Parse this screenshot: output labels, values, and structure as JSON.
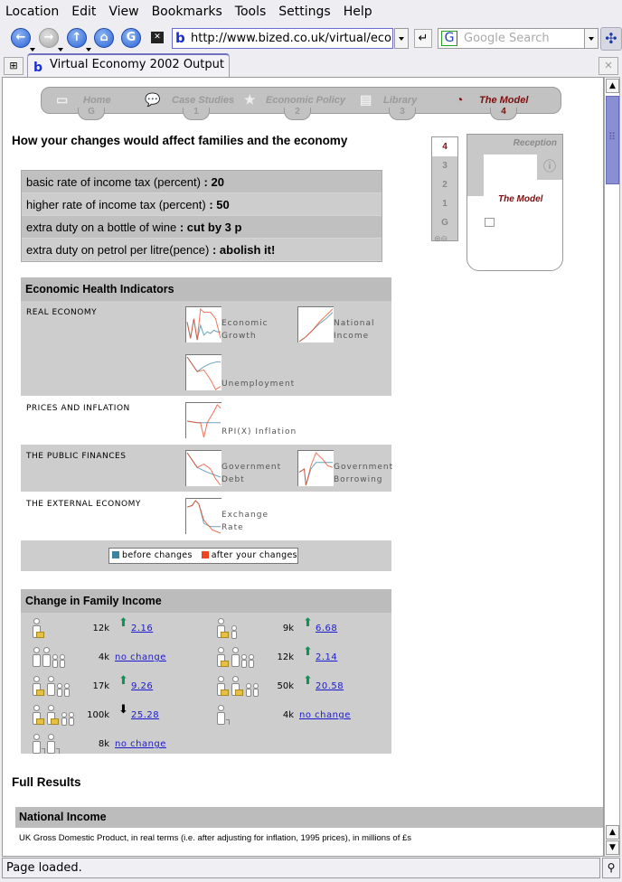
{
  "browser": {
    "menu": [
      "Location",
      "Edit",
      "View",
      "Bookmarks",
      "Tools",
      "Settings",
      "Help"
    ],
    "url": "http://www.bized.co.uk/virtual/econc",
    "search_placeholder": "Google Search",
    "tab_title": "Virtual Economy 2002 Output",
    "status": "Page loaded.",
    "icons": {
      "back": "back-arrow-icon",
      "forward": "forward-arrow-icon",
      "up": "up-arrow-icon",
      "home": "home-icon",
      "reload": "reload-icon",
      "stop": "stop-icon"
    }
  },
  "site_nav": {
    "items": [
      {
        "label": "Home",
        "floor": "G",
        "icon": "briefcase-icon",
        "active": false
      },
      {
        "label": "Case Studies",
        "floor": "1",
        "icon": "speech-bubbles-icon",
        "active": false
      },
      {
        "label": "Economic Policy",
        "floor": "2",
        "icon": "star-icon",
        "active": false
      },
      {
        "label": "Library",
        "floor": "3",
        "icon": "book-icon",
        "active": false
      },
      {
        "label": "The Model",
        "floor": "4",
        "icon": "pie-chart-icon",
        "active": true
      }
    ]
  },
  "lift": {
    "floors": [
      "4",
      "3",
      "2",
      "1",
      "G"
    ],
    "current": "4"
  },
  "floor_map": {
    "reception": "Reception",
    "room": "The Model"
  },
  "page": {
    "heading": "How your changes would affect families and the economy",
    "policies": [
      {
        "label": "basic rate of income tax (percent)",
        "value": ": 20"
      },
      {
        "label": "higher rate of income tax (percent)",
        "value": ": 50"
      },
      {
        "label": "extra duty on a bottle of wine",
        "value": ": cut by 3 p"
      },
      {
        "label": "extra duty on petrol per litre(pence)",
        "value": ": abolish it!"
      }
    ]
  },
  "indicators": {
    "title": "Economic Health Indicators",
    "sections": [
      {
        "name": "REAL ECONOMY",
        "charts": [
          {
            "label1": "Economic",
            "label2": "Growth"
          },
          {
            "label1": "National",
            "label2": "Income"
          },
          {
            "label1": "",
            "label2": "Unemployment"
          }
        ]
      },
      {
        "name": "PRICES AND INFLATION",
        "charts": [
          {
            "label1": "",
            "label2": "RPI(X) Inflation"
          }
        ]
      },
      {
        "name": "THE PUBLIC FINANCES",
        "charts": [
          {
            "label1": "Government",
            "label2": "Debt"
          },
          {
            "label1": "Government",
            "label2": "Borrowing"
          }
        ]
      },
      {
        "name": "THE EXTERNAL ECONOMY",
        "charts": [
          {
            "label1": "Exchange",
            "label2": "Rate"
          }
        ]
      }
    ],
    "legend": {
      "before": "before changes",
      "after": "after your changes",
      "before_color": "#3a86a0",
      "after_color": "#ee4422"
    }
  },
  "family_income": {
    "title": "Change in Family Income",
    "items": [
      {
        "family": "single-worker",
        "income": "12k",
        "direction": "up",
        "change": "2.16"
      },
      {
        "family": "single-worker-one-child",
        "income": "9k",
        "direction": "up",
        "change": "6.68"
      },
      {
        "family": "couple-two-children-no-worker",
        "income": "4k",
        "direction": "none",
        "change": "no change"
      },
      {
        "family": "couple-one-worker-two-children",
        "income": "12k",
        "direction": "up",
        "change": "2.14"
      },
      {
        "family": "couple-one-worker-two-children",
        "income": "17k",
        "direction": "up",
        "change": "9.26"
      },
      {
        "family": "couple-two-workers-two-children",
        "income": "50k",
        "direction": "up",
        "change": "20.58"
      },
      {
        "family": "couple-two-workers-two-children",
        "income": "100k",
        "direction": "down",
        "change": "25.28"
      },
      {
        "family": "single-pensioner",
        "income": "4k",
        "direction": "none",
        "change": "no change"
      },
      {
        "family": "pensioner-couple",
        "income": "8k",
        "direction": "none",
        "change": "no change"
      }
    ]
  },
  "full_results": {
    "title": "Full Results",
    "section": "National Income",
    "description": "UK Gross Domestic Product, in real terms (i.e. after adjusting for inflation, 1995 prices), in millions of £s"
  },
  "colors": {
    "accent_active": "#7a1010",
    "link": "#1a1ad0",
    "arrow_up": "#119055",
    "arrow_down": "#d03a1a"
  }
}
